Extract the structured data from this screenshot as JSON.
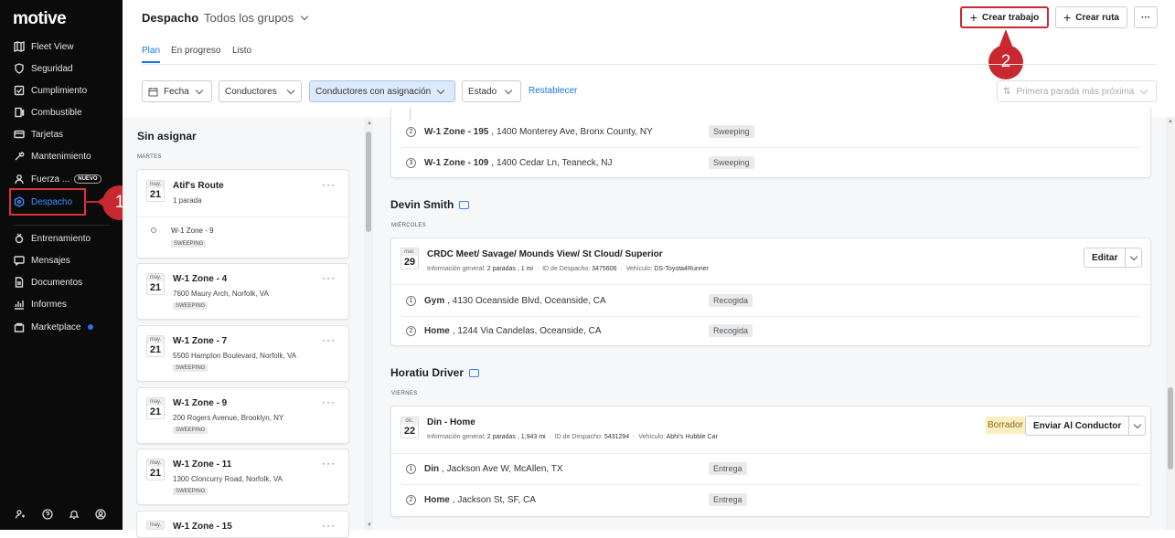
{
  "app": {
    "logo": "motive"
  },
  "sidebar": {
    "items": [
      {
        "label": "Fleet View",
        "icon": "map-icon"
      },
      {
        "label": "Seguridad",
        "icon": "shield-icon"
      },
      {
        "label": "Cumplimiento",
        "icon": "compliance-icon"
      },
      {
        "label": "Combustible",
        "icon": "fuel-icon"
      },
      {
        "label": "Tarjetas",
        "icon": "card-icon"
      },
      {
        "label": "Mantenimiento",
        "icon": "wrench-icon"
      },
      {
        "label": "Fuerza ...",
        "icon": "person-icon",
        "badge": "NUEVO"
      },
      {
        "label": "Despacho",
        "icon": "dispatch-icon",
        "active": true
      },
      {
        "label": "Entrenamiento",
        "icon": "training-icon"
      },
      {
        "label": "Mensajes",
        "icon": "messages-icon"
      },
      {
        "label": "Documentos",
        "icon": "documents-icon"
      },
      {
        "label": "Informes",
        "icon": "reports-icon"
      },
      {
        "label": "Marketplace",
        "icon": "marketplace-icon",
        "dot": true
      }
    ]
  },
  "callouts": {
    "one": "1",
    "two": "2"
  },
  "header": {
    "title": "Despacho",
    "group": "Todos los grupos",
    "create_job": "Crear trabajo",
    "create_route": "Crear ruta",
    "more": "···"
  },
  "tabs": [
    "Plan",
    "En progreso",
    "Listo"
  ],
  "filters": {
    "date": "Fecha",
    "drivers": "Conductores",
    "assigned": "Conductores con asignación",
    "status": "Estado",
    "reset": "Restablecer",
    "sort": "Primera parada más próxima"
  },
  "unassigned": {
    "title": "Sin asignar",
    "day": "MARTES",
    "route": {
      "month": "may.",
      "day": "21",
      "title": "Atif's Route",
      "sub": "1 parada",
      "stop": "W-1 Zone - 9",
      "tag": "SWEEPING"
    },
    "cards": [
      {
        "month": "may.",
        "day": "21",
        "title": "W-1 Zone - 4",
        "address": "7600 Maury Arch, Norfolk, VA",
        "tag": "SWEEPING"
      },
      {
        "month": "may.",
        "day": "21",
        "title": "W-1 Zone - 7",
        "address": "5500 Hampton Boulevard, Norfolk, VA",
        "tag": "SWEEPING"
      },
      {
        "month": "may.",
        "day": "21",
        "title": "W-1 Zone - 9",
        "address": "200 Rogers Avenue, Brooklyn, NY",
        "tag": "SWEEPING"
      },
      {
        "month": "may.",
        "day": "21",
        "title": "W-1 Zone - 11",
        "address": "1300 Cloncurry Road, Norfolk, VA",
        "tag": "SWEEPING"
      },
      {
        "month": "may.",
        "day": "",
        "title": "W-1 Zone - 15",
        "address": "",
        "tag": ""
      }
    ]
  },
  "top_panel": {
    "stops": [
      {
        "n": "2",
        "name": "W-1 Zone - 195",
        "address": "1400 Monterey Ave, Bronx County, NY",
        "tag": "Sweeping"
      },
      {
        "n": "3",
        "name": "W-1 Zone - 109",
        "address": "1400 Cedar Ln, Teaneck, NJ",
        "tag": "Sweeping"
      }
    ]
  },
  "drivers": [
    {
      "name": "Devin Smith",
      "day": "MIÉRCOLES",
      "month": "mar.",
      "date": "29",
      "route": "CRDC Meet/ Savage/ Mounds View/ St Cloud/ Superior",
      "info_label": "Información general:",
      "info_value": "2 paradas , 1 mi",
      "id_label": "ID de Despacho:",
      "id_value": "3475606",
      "vehicle_label": "Vehículo:",
      "vehicle_value": "DS-Toyota4Runner",
      "action": "Editar",
      "stops": [
        {
          "n": "1",
          "name": "Gym",
          "address": "4130 Oceanside Blvd, Oceanside, CA",
          "tag": "Recogida"
        },
        {
          "n": "2",
          "name": "Home",
          "address": "1244 Via Candelas, Oceanside, CA",
          "tag": "Recogida"
        }
      ]
    },
    {
      "name": "Horatiu Driver",
      "day": "VIERNES",
      "month": "dic.",
      "date": "22",
      "route": "Din - Home",
      "info_label": "Información general:",
      "info_value": "2 paradas , 1,943 mi",
      "id_label": "ID de Despacho:",
      "id_value": "5431294",
      "vehicle_label": "Vehículo:",
      "vehicle_value": "Abhi's Hubble Car",
      "status": "Borrador",
      "action": "Enviar Al Conductor",
      "stops": [
        {
          "n": "1",
          "name": "Din",
          "address": "Jackson Ave W, McAllen, TX",
          "tag": "Entrega"
        },
        {
          "n": "2",
          "name": "Home",
          "address": "Jackson St, SF, CA",
          "tag": "Entrega"
        }
      ]
    }
  ],
  "colors": {
    "accent": "#1a73e8",
    "callout": "#c8282f",
    "sidebar": "#0b0b0c",
    "draft": "#fbeec1"
  }
}
